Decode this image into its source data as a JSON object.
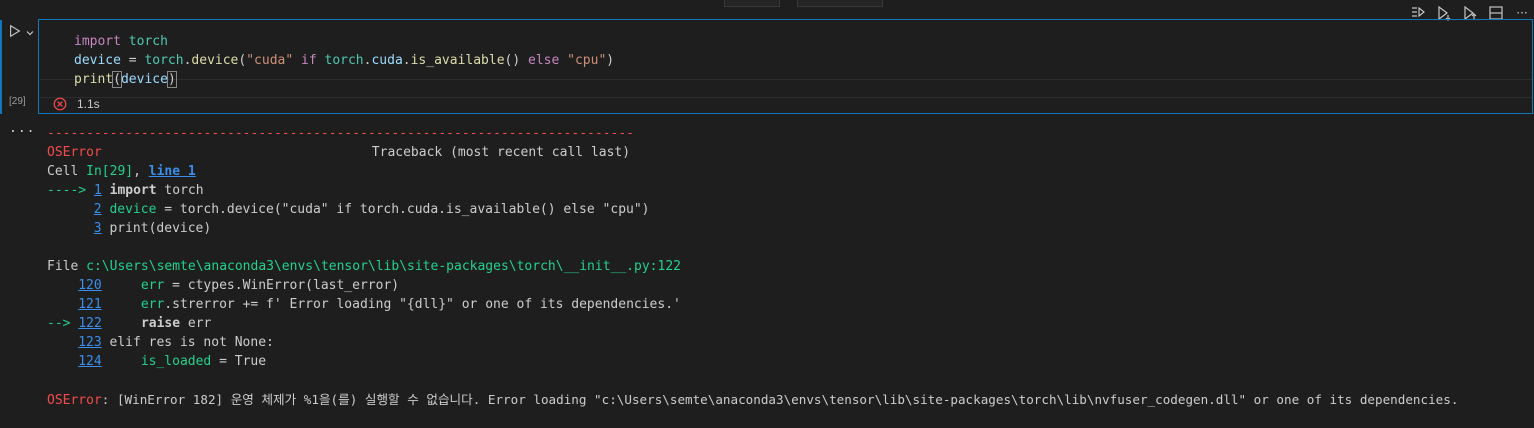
{
  "toolbar": {
    "icons": [
      "run-by-line-icon",
      "execute-above-icon",
      "execute-below-icon",
      "split-cell-icon",
      "more-icon"
    ],
    "more_label": "···"
  },
  "cell": {
    "execution_count": "[29]",
    "status_time": "1.1s",
    "code": {
      "line1": {
        "kw": "import",
        "mod": "torch"
      },
      "line2": {
        "a": "device",
        "b": " = ",
        "c": "torch",
        "d": ".",
        "e": "device",
        "f": "(",
        "g": "\"cuda\"",
        "h": " if ",
        "i": "torch",
        "j": ".",
        "k": "cuda",
        "l": ".",
        "m": "is_available",
        "n": "()",
        "o": " else ",
        "p": "\"cpu\"",
        "q": ")"
      },
      "line3": {
        "fn": "print",
        "open": "(",
        "arg": "device",
        "close": ")"
      }
    }
  },
  "output": {
    "ellipsis": "...",
    "separator": "---------------------------------------------------------------------------",
    "error_name": "OSError",
    "traceback_header": "Traceback (most recent call last)",
    "cell_prefix": "Cell ",
    "cell_ref": "In[29]",
    "cell_sep": ", ",
    "cell_line": "line 1",
    "arrow1": "----> ",
    "tb1": [
      {
        "num": "1",
        "text_kw": "import",
        "text_rest": " torch"
      },
      {
        "num": "2",
        "text_var": "device",
        "text_rest": " = torch.device(\"cuda\" if torch.cuda.is_available() else \"cpu\")"
      },
      {
        "num": "3",
        "text": "print(device)"
      }
    ],
    "file_prefix": "File ",
    "file_path": "c:\\Users\\semte\\anaconda3\\envs\\tensor\\lib\\site-packages\\torch\\__init__.py:122",
    "arrow2": "--> ",
    "tb2": [
      {
        "num": "120",
        "indent": "    ",
        "text_var": "err",
        "text_rest": " = ctypes.WinError(last_error)"
      },
      {
        "num": "121",
        "indent": "    ",
        "text_var": "err",
        "text_rest": ".strerror += f' Error loading \"{dll}\" or one of its dependencies.'"
      },
      {
        "num": "122",
        "indent": "    ",
        "text_kw": "raise",
        "text_rest": " err"
      },
      {
        "num": "123",
        "indent": "",
        "text": "elif res is not None:"
      },
      {
        "num": "124",
        "indent": "    ",
        "text_var": "is_loaded",
        "text_rest": " = True"
      }
    ],
    "final_error_name": "OSError",
    "final_message": ": [WinError 182] 운영 체제가 %1을(를) 실행할 수 없습니다. Error loading \"c:\\Users\\semte\\anaconda3\\envs\\tensor\\lib\\site-packages\\torch\\lib\\nvfuser_codegen.dll\" or one of its dependencies."
  }
}
